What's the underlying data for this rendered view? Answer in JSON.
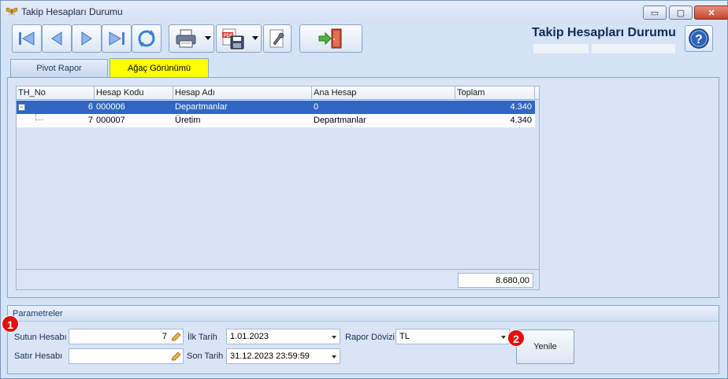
{
  "window": {
    "title": "Takip Hesapları Durumu",
    "controls": {
      "minimize": "▭",
      "maximize": "▢",
      "close": "✕"
    }
  },
  "header": {
    "report_title": "Takip Hesapları Durumu"
  },
  "toolbar": {
    "icons": [
      "first-icon",
      "prev-icon",
      "next-icon",
      "last-icon",
      "refresh-icon",
      "print-icon",
      "pdf-save-icon",
      "settings-icon",
      "exit-icon",
      "help-icon"
    ]
  },
  "tabs": [
    {
      "label": "Pivot Rapor",
      "active": false
    },
    {
      "label": "Ağaç Görünümü",
      "active": true
    }
  ],
  "grid": {
    "columns": [
      "TH_No",
      "Hesap Kodu",
      "Hesap Adı",
      "Ana Hesap",
      "Toplam"
    ],
    "rows": [
      {
        "th_no": "6",
        "hesap_kodu": "000006",
        "hesap_adi": "Departmanlar",
        "ana_hesap": "0",
        "toplam": "4.340",
        "selected": true
      },
      {
        "th_no": "7",
        "hesap_kodu": "000007",
        "hesap_adi": "Üretim",
        "ana_hesap": "Departmanlar",
        "toplam": "4.340",
        "selected": false
      }
    ],
    "tree_toggle": "−",
    "footer_total": "8.680,00"
  },
  "params": {
    "title": "Parametreler",
    "sutun_hesabi_label": "Sutun Hesabı",
    "sutun_hesabi_value": "7",
    "satir_hesabi_label": "Satır Hesabı",
    "satir_hesabi_value": "",
    "ilk_tarih_label": "İlk Tarih",
    "ilk_tarih_value": "1.01.2023",
    "son_tarih_label": "Son Tarih",
    "son_tarih_value": "31.12.2023 23:59:59",
    "rapor_dovizi_label": "Rapor Dövizi",
    "rapor_dovizi_value": "TL",
    "yenile_label": "Yenile"
  },
  "markers": [
    "1",
    "2"
  ],
  "colors": {
    "selected_row": "#3167c4",
    "active_tab": "#ffff00",
    "marker": "#e5100e"
  }
}
